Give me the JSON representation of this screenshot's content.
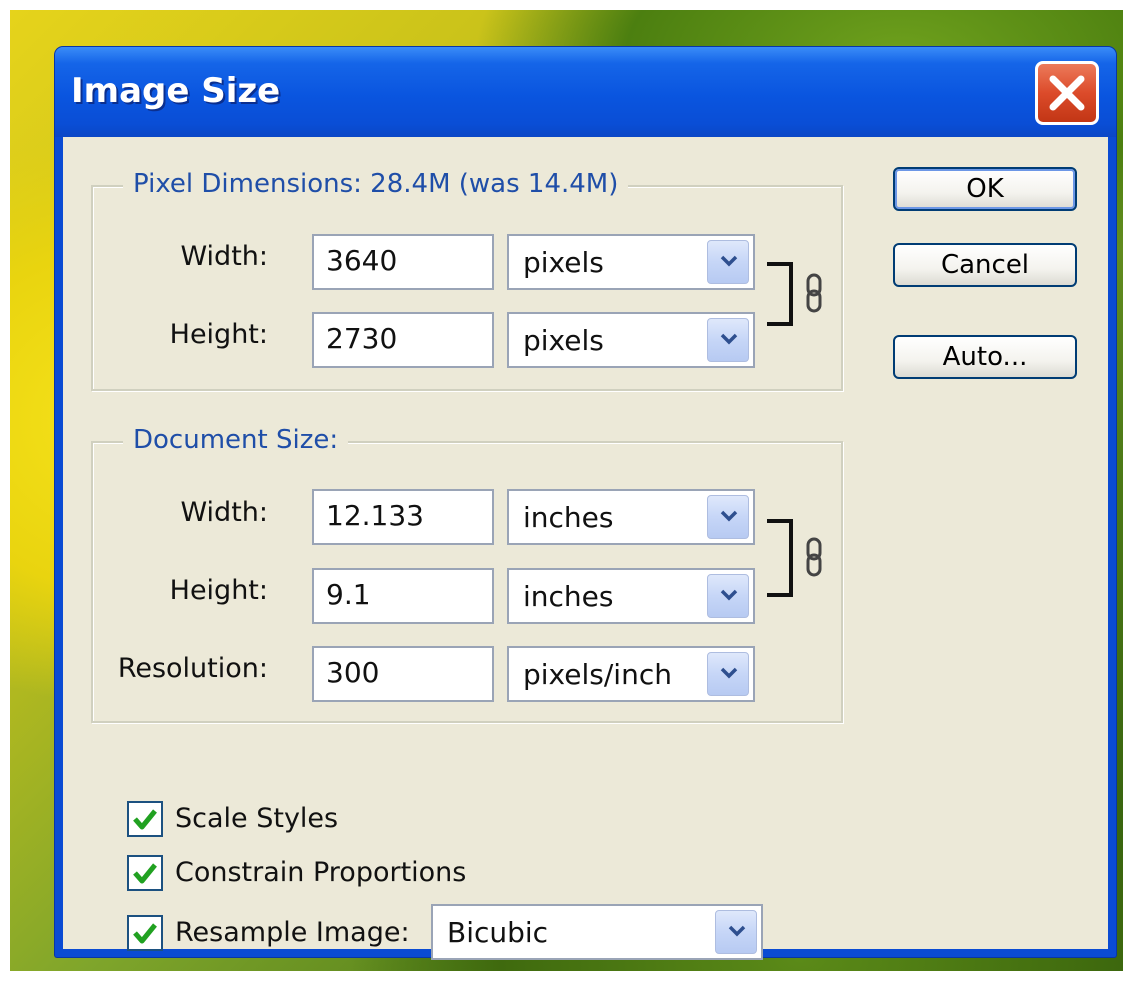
{
  "dialog": {
    "title": "Image Size"
  },
  "pixel_dimensions": {
    "legend": "Pixel Dimensions:  28.4M (was 14.4M)",
    "width_label": "Width:",
    "width_value": "3640",
    "width_unit": "pixels",
    "height_label": "Height:",
    "height_value": "2730",
    "height_unit": "pixels"
  },
  "document_size": {
    "legend": "Document Size:",
    "width_label": "Width:",
    "width_value": "12.133",
    "width_unit": "inches",
    "height_label": "Height:",
    "height_value": "9.1",
    "height_unit": "inches",
    "resolution_label": "Resolution:",
    "resolution_value": "300",
    "resolution_unit": "pixels/inch"
  },
  "buttons": {
    "ok": "OK",
    "cancel": "Cancel",
    "auto": "Auto..."
  },
  "options": {
    "scale_styles": "Scale Styles",
    "scale_styles_checked": true,
    "constrain_proportions": "Constrain Proportions",
    "constrain_proportions_checked": true,
    "resample_image": "Resample Image:",
    "resample_image_checked": true,
    "resample_method": "Bicubic"
  },
  "icons": [
    "close-icon",
    "chevron-down-icon",
    "chain-link-icon",
    "checkmark-icon"
  ],
  "colors": {
    "title_bar": "#0a55df",
    "legend_text": "#1f4ea8",
    "dialog_bg": "#ece9d8",
    "check_green": "#21a121"
  }
}
